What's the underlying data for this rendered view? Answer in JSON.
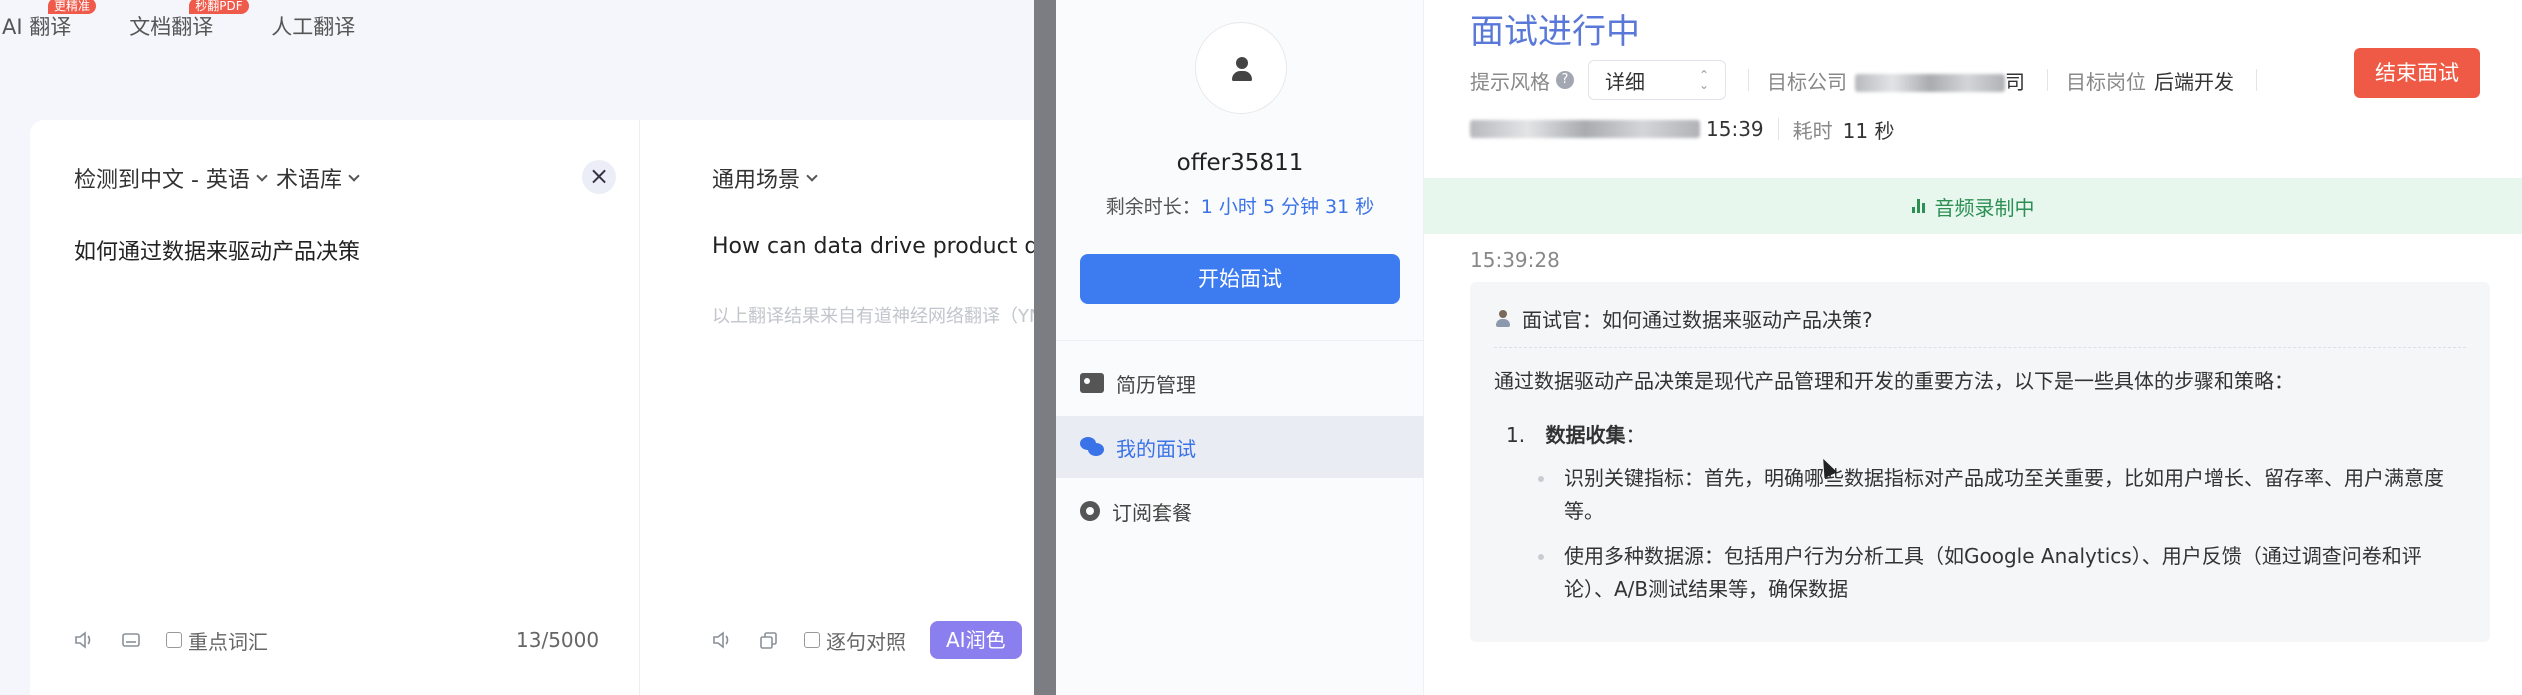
{
  "translator": {
    "tabs": [
      {
        "label": "AI 翻译",
        "badge": "更精准"
      },
      {
        "label": "文档翻译",
        "badge": "秒翻PDF"
      },
      {
        "label": "人工翻译",
        "badge": ""
      }
    ],
    "lang_select": "检测到中文 - 英语",
    "glossary": "术语库",
    "clear_glyph": "×",
    "scene_select": "通用场景",
    "source_text": "如何通过数据来驱动产品决策",
    "target_text": "How can data drive product dec",
    "target_note": "以上翻译结果来自有道神经网络翻译（YNMT）",
    "key_words": "重点词汇",
    "char_count": "13/5000",
    "sentence_compare": "逐句对照",
    "ai_polish": "AI润色"
  },
  "sidebar": {
    "username": "offer35811",
    "remaining_label": "剩余时长：",
    "remaining_value": "1 小时 5 分钟 31 秒",
    "start_button": "开始面试",
    "nav": [
      {
        "label": "简历管理",
        "icon": "id-card-icon"
      },
      {
        "label": "我的面试",
        "icon": "chat-bubbles-icon"
      },
      {
        "label": "订阅套餐",
        "icon": "subscription-icon"
      }
    ]
  },
  "interview": {
    "title": "面试进行中",
    "hint_style_label": "提示风格",
    "help_glyph": "?",
    "hint_style_value": "详细",
    "company_label": "目标公司",
    "company_suffix": "司",
    "position_label": "目标岗位",
    "position_value": "后端开发",
    "start_time": "15:39",
    "elapsed_label": "耗时",
    "elapsed_value": "11 秒",
    "end_button": "结束面试",
    "recording": "音频录制中",
    "timestamp": "15:39:28",
    "question": "面试官：如何通过数据来驱动产品决策?",
    "answer_intro": "通过数据驱动产品决策是现代产品管理和开发的重要方法，以下是一些具体的步骤和策略：",
    "step1_num": "1.",
    "step1_title": "数据收集",
    "step1_colon": "：",
    "bullets": [
      "识别关键指标：首先，明确哪些数据指标对产品成功至关重要，比如用户增长、留存率、用户满意度等。",
      "使用多种数据源：包括用户行为分析工具（如Google Analytics）、用户反馈（通过调查问卷和评论）、A/B测试结果等，确保数据"
    ]
  }
}
